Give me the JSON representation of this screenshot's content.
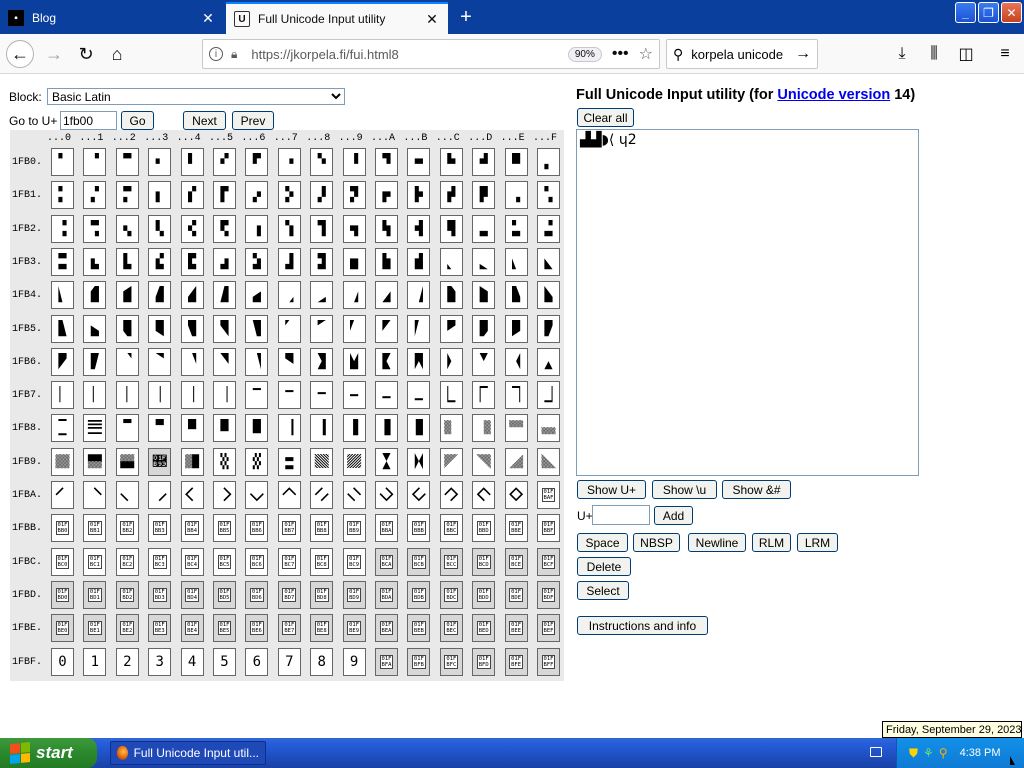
{
  "browser": {
    "tabs": [
      {
        "title": "Blog",
        "active": false
      },
      {
        "title": "Full Unicode Input utility",
        "active": true
      }
    ],
    "url_text": "https://jkorpela.fi/fui.html8",
    "zoom": "90%",
    "search_value": "korpela unicode"
  },
  "page": {
    "block_label": "Block:",
    "block_selected": "Basic Latin",
    "goto_label": "Go to U+",
    "goto_value": "1fb00",
    "go_label": "Go",
    "next_label": "Next",
    "prev_label": "Prev",
    "title_prefix": "Full Unicode Input utility (for ",
    "title_link": "Unicode version",
    "title_suffix": " 14)",
    "clear_label": "Clear all",
    "output_text": "▟▟◗⟨ ɥ2",
    "show_uplus_label": "Show U+",
    "show_u_label": "Show \\u",
    "show_amp_label": "Show &#",
    "uplus_label": "U+",
    "add_label": "Add",
    "space_label": "Space",
    "nbsp_label": "NBSP",
    "newline_label": "Newline",
    "rlm_label": "RLM",
    "lrm_label": "LRM",
    "delete_label": "Delete",
    "select_label": "Select",
    "instructions_label": "Instructions and info"
  },
  "grid": {
    "columns": [
      "...0",
      "...1",
      "...2",
      "...3",
      "...4",
      "...5",
      "...6",
      "...7",
      "...8",
      "...9",
      "...A",
      "...B",
      "...C",
      "...D",
      "...E",
      "...F"
    ],
    "rows": [
      "1FB0.",
      "1FB1.",
      "1FB2.",
      "1FB3.",
      "1FB4.",
      "1FB5.",
      "1FB6.",
      "1FB7.",
      "1FB8.",
      "1FB9.",
      "1FBA.",
      "1FBB.",
      "1FBC.",
      "1FBD.",
      "1FBE.",
      "1FBF."
    ]
  },
  "taskbar": {
    "start_label": "start",
    "task_label": "Full Unicode Input util...",
    "clock": "4:38 PM",
    "tooltip": "Friday, September 29, 2023"
  }
}
